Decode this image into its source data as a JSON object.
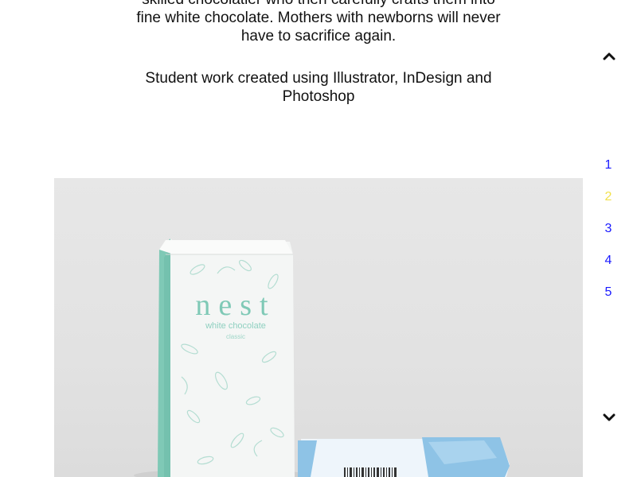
{
  "description": {
    "lines": [
      "skilled chocolatier who then carefully crafts them into",
      "fine white chocolate. Mothers with newborns will never",
      "have to sacrifice again."
    ],
    "credit": "Student work created using Illustrator, InDesign and Photoshop"
  },
  "nav": {
    "up_icon": "chevron-up-icon",
    "down_icon": "chevron-down-icon",
    "pages": [
      {
        "label": "1",
        "color": "#1a1aff"
      },
      {
        "label": "2",
        "color": "#f2e14c"
      },
      {
        "label": "3",
        "color": "#1a1aff"
      },
      {
        "label": "4",
        "color": "#1a1aff"
      },
      {
        "label": "5",
        "color": "#1a1aff"
      }
    ],
    "active_page": "2"
  },
  "product": {
    "brand": "nest",
    "flavor": "white chocolate",
    "variant": "classic",
    "bag_color": "#f4f6f5",
    "accent_color": "#7fc9b6",
    "box_color": "#8ec3e6"
  }
}
